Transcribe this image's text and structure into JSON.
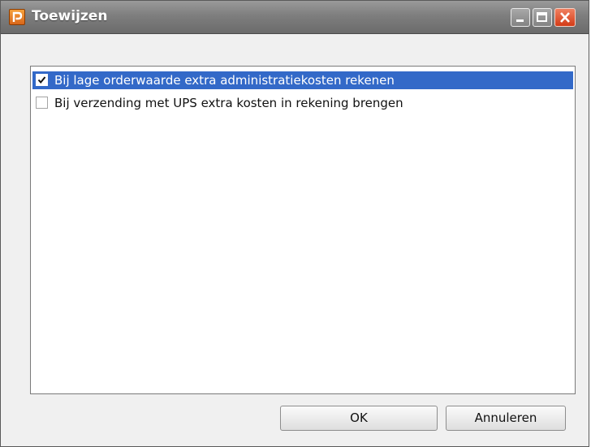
{
  "window": {
    "title": "Toewijzen",
    "icon": "app-logo-icon"
  },
  "titlebar_buttons": {
    "minimize": "minimize-icon",
    "maximize": "maximize-icon",
    "close": "close-icon"
  },
  "list": {
    "items": [
      {
        "label": "Bij lage orderwaarde extra administratiekosten rekenen",
        "checked": true,
        "selected": true
      },
      {
        "label": "Bij verzending met UPS extra kosten in rekening brengen",
        "checked": false,
        "selected": false
      }
    ]
  },
  "buttons": {
    "ok": "OK",
    "cancel": "Annuleren"
  },
  "colors": {
    "selection": "#3369c8",
    "titlebar": "#7e7e7e",
    "close_button": "#d43b16"
  }
}
